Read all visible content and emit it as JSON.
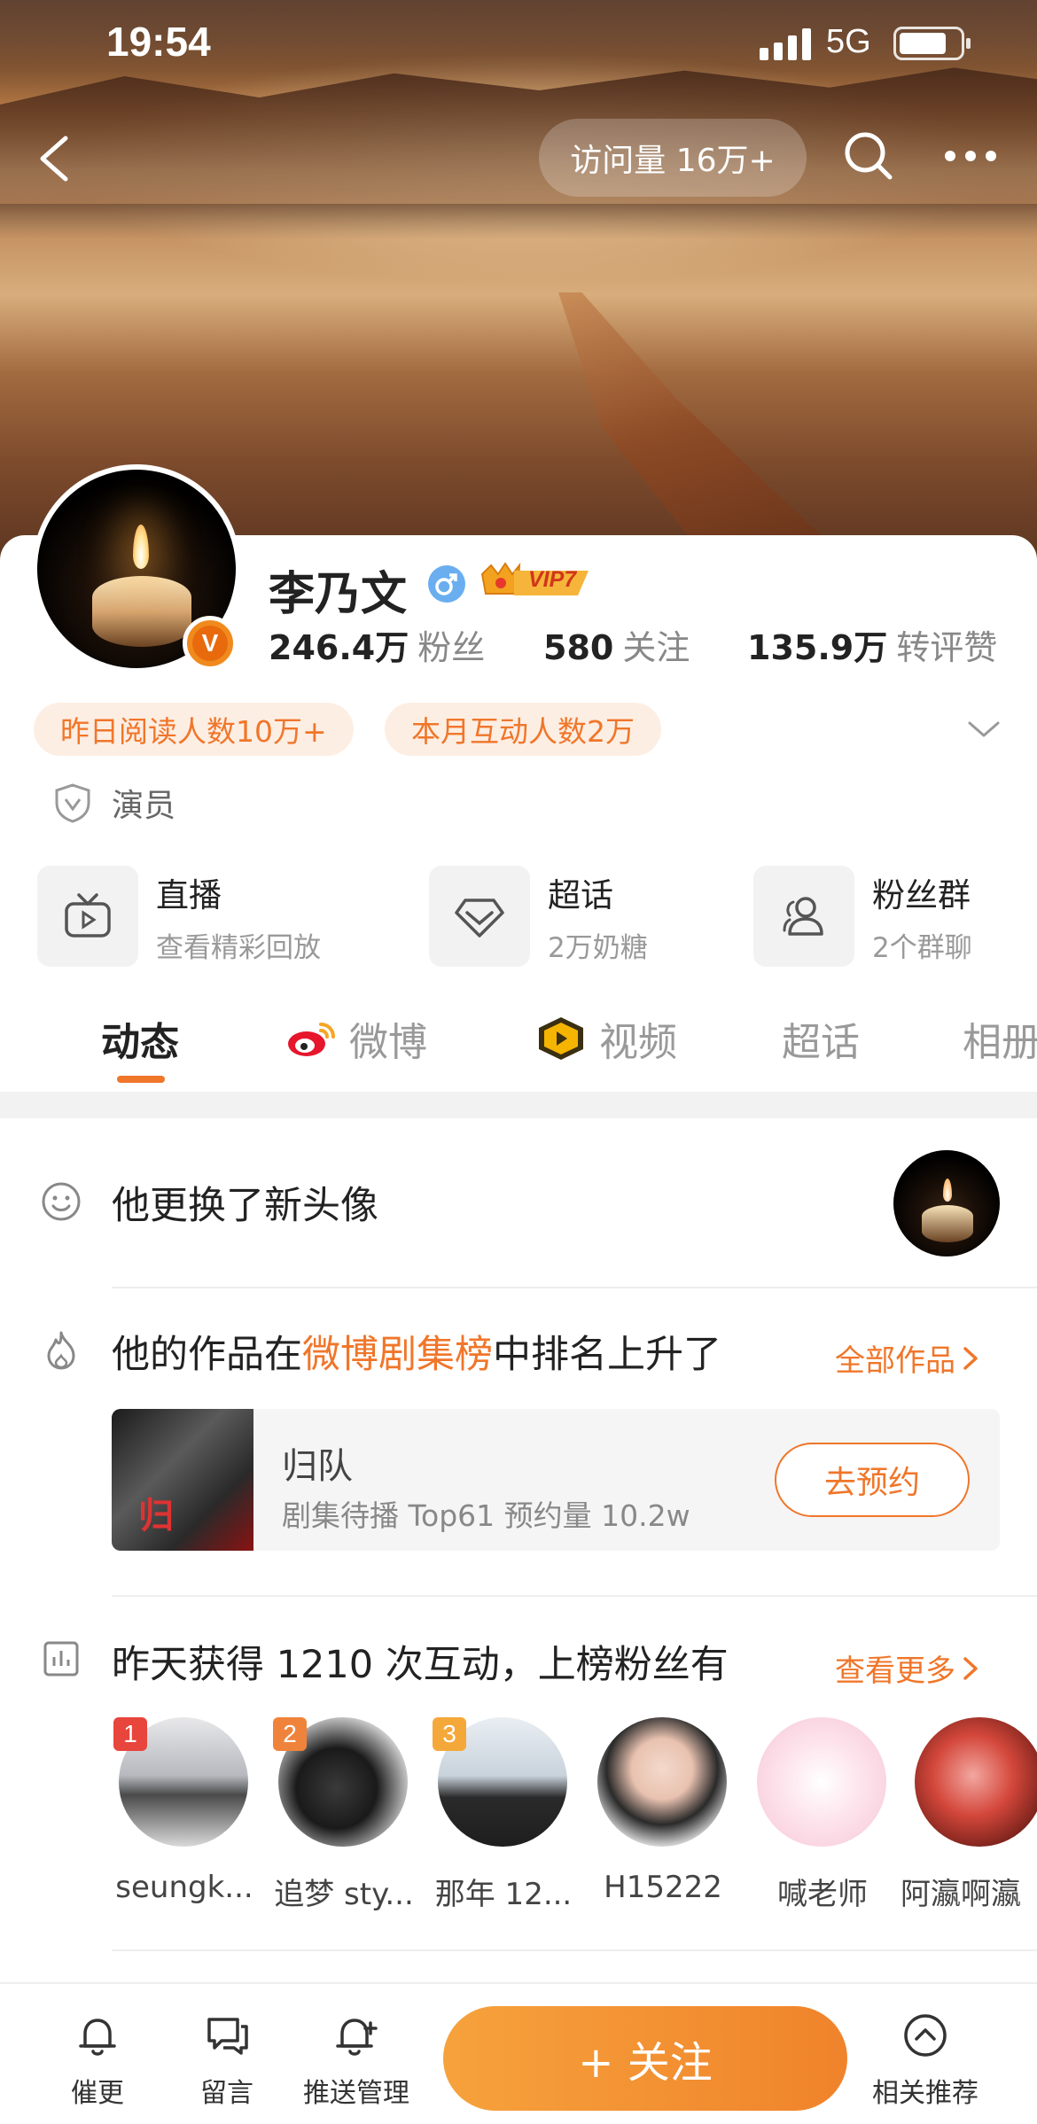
{
  "status_bar": {
    "time": "19:54",
    "network": "5G"
  },
  "topbar": {
    "visit_count": "访问量 16万+"
  },
  "profile": {
    "name": "李乃文",
    "vip_label": "VIP7",
    "verified_badge": "V",
    "stats": [
      {
        "num": "246.4万",
        "label": "粉丝"
      },
      {
        "num": "580",
        "label": "关注"
      },
      {
        "num": "135.9万",
        "label": "转评赞"
      }
    ],
    "tags": [
      "昨日阅读人数10万+",
      "本月互动人数2万"
    ],
    "role": "演员"
  },
  "features": [
    {
      "title": "直播",
      "sub": "查看精彩回放",
      "icon": "tv-icon"
    },
    {
      "title": "超话",
      "sub": "2万奶糖",
      "icon": "diamond-icon"
    },
    {
      "title": "粉丝群",
      "sub": "2个群聊",
      "icon": "group-icon"
    }
  ],
  "tabs": [
    {
      "label": "动态",
      "active": true
    },
    {
      "label": "微博"
    },
    {
      "label": "视频"
    },
    {
      "label": "超话"
    },
    {
      "label": "相册"
    }
  ],
  "feed": {
    "avatar_update": "他更换了新头像",
    "ranking": {
      "prefix": "他的作品在",
      "highlight": "微博剧集榜",
      "suffix": "中排名上升了",
      "more": "全部作品",
      "work_title": "归队",
      "work_sub": "剧集待播 Top61 预约量 10.2w",
      "reserve": "去预约",
      "thumb_text": "归"
    },
    "interaction": {
      "title": "昨天获得 1210 次互动，上榜粉丝有",
      "more": "查看更多",
      "fans": [
        {
          "rank": "1",
          "name": "seungk..."
        },
        {
          "rank": "2",
          "name": "追梦 sty..."
        },
        {
          "rank": "3",
          "name": "那年 12..."
        },
        {
          "rank": "",
          "name": "H15222"
        },
        {
          "rank": "",
          "name": "喊老师"
        },
        {
          "rank": "",
          "name": "阿瀛啊瀛"
        }
      ]
    }
  },
  "bottom_bar": {
    "items": [
      "催更",
      "留言",
      "推送管理",
      "相关推荐"
    ],
    "follow": "+ 关注"
  },
  "colors": {
    "accent": "#f0762a",
    "tag_bg": "#fdeee3",
    "follow_gradient_start": "#f6a23c",
    "follow_gradient_end": "#f0832b"
  }
}
